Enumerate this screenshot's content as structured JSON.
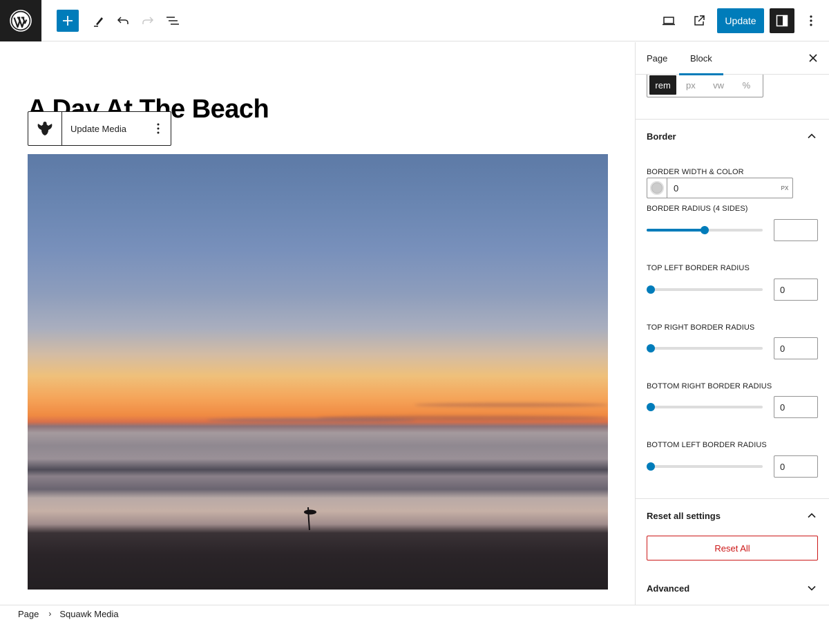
{
  "toolbar": {
    "update_label": "Update",
    "icons": [
      "wordpress-logo",
      "add-block",
      "edit-tools",
      "undo",
      "redo",
      "document-overview",
      "preview-device",
      "view-post-external",
      "settings",
      "options"
    ]
  },
  "editor": {
    "title": "A Day At The Beach",
    "block_toolbar": {
      "icon": "squawk-bird",
      "label": "Update Media"
    },
    "image_alt": "Sunset over the ocean with a surfer silhouette on the beach"
  },
  "sidebar": {
    "tabs": [
      {
        "label": "Page",
        "active": false
      },
      {
        "label": "Block",
        "active": true
      }
    ],
    "units": [
      {
        "label": "rem",
        "active": true
      },
      {
        "label": "px",
        "active": false
      },
      {
        "label": "vw",
        "active": false
      },
      {
        "label": "%",
        "active": false
      }
    ],
    "border_panel": {
      "title": "Border",
      "expanded": true,
      "border_width_label": "Border width & color",
      "border_width_value": "0",
      "border_width_unit": "PX",
      "border_color": "#cccccc",
      "radius_all_label": "Border radius (4 sides)",
      "radius_all_value": "",
      "radius_all_slider": 0.5,
      "corners": [
        {
          "label": "Top left border radius",
          "value": "0",
          "slider": 0
        },
        {
          "label": "Top right border radius",
          "value": "0",
          "slider": 0
        },
        {
          "label": "Bottom right border radius",
          "value": "0",
          "slider": 0
        },
        {
          "label": "Bottom left border radius",
          "value": "0",
          "slider": 0
        }
      ]
    },
    "reset_panel": {
      "title": "Reset all settings",
      "expanded": true,
      "button_label": "Reset All"
    },
    "advanced_panel": {
      "title": "Advanced",
      "expanded": false
    }
  },
  "breadcrumb": {
    "items": [
      "Page",
      "Squawk Media"
    ]
  },
  "colors": {
    "accent": "#007cba",
    "dark": "#1e1e1e",
    "danger": "#cc1818",
    "border": "#e0e0e0"
  }
}
